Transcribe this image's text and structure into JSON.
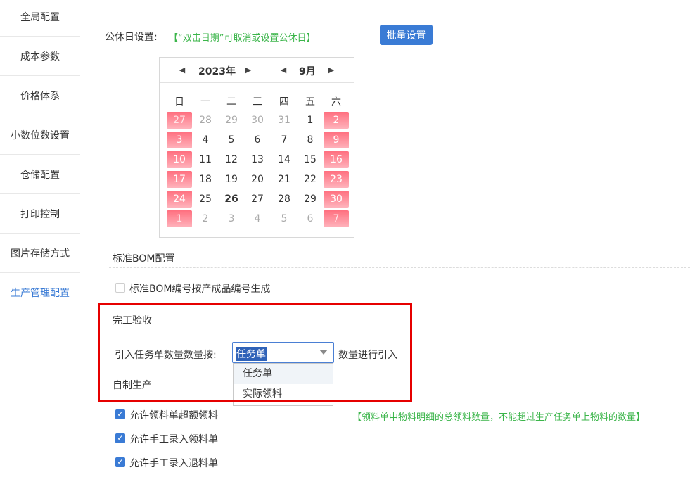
{
  "sidebar": {
    "items": [
      {
        "label": "全局配置"
      },
      {
        "label": "成本参数"
      },
      {
        "label": "价格体系"
      },
      {
        "label": "小数位数设置"
      },
      {
        "label": "仓储配置"
      },
      {
        "label": "打印控制"
      },
      {
        "label": "图片存储方式"
      },
      {
        "label": "生产管理配置",
        "active": true
      }
    ]
  },
  "holiday": {
    "label": "公休日设置:",
    "hint": "【“双击日期”可取消或设置公休日】",
    "batch_button": "批量设置"
  },
  "calendar": {
    "year": "2023年",
    "month": "9月",
    "weekdays": [
      "日",
      "一",
      "二",
      "三",
      "四",
      "五",
      "六"
    ],
    "today": "26",
    "weeks": [
      [
        "27",
        "28",
        "29",
        "30",
        "31",
        "1",
        "2"
      ],
      [
        "3",
        "4",
        "5",
        "6",
        "7",
        "8",
        "9"
      ],
      [
        "10",
        "11",
        "12",
        "13",
        "14",
        "15",
        "16"
      ],
      [
        "17",
        "18",
        "19",
        "20",
        "21",
        "22",
        "23"
      ],
      [
        "24",
        "25",
        "26",
        "27",
        "28",
        "29",
        "30"
      ],
      [
        "1",
        "2",
        "3",
        "4",
        "5",
        "6",
        "7"
      ]
    ],
    "colors": {
      "holiday": "#ff7a89",
      "muted": "#a9a9a9"
    }
  },
  "bom": {
    "title": "标准BOM配置",
    "checkbox_label": "标准BOM编号按产成品编号生成",
    "checked": false
  },
  "acceptance": {
    "title": "完工验收",
    "label": "引入任务单数量数量按:",
    "selected": "任务单",
    "options": [
      "任务单",
      "实际领料"
    ],
    "suffix": "数量进行引入"
  },
  "self_production": {
    "title": "自制生产",
    "options": [
      {
        "label": "允许领料单超额领料",
        "checked": true
      },
      {
        "label": "允许手工录入领料单",
        "checked": true
      },
      {
        "label": "允许手工录入退料单",
        "checked": true
      }
    ],
    "note": "【领料单中物料明细的总领料数量，不能超过生产任务单上物料的数量】"
  },
  "colors": {
    "accent": "#3a7bd5",
    "hint_green": "#3bb54a",
    "highlight": "#e60000"
  }
}
